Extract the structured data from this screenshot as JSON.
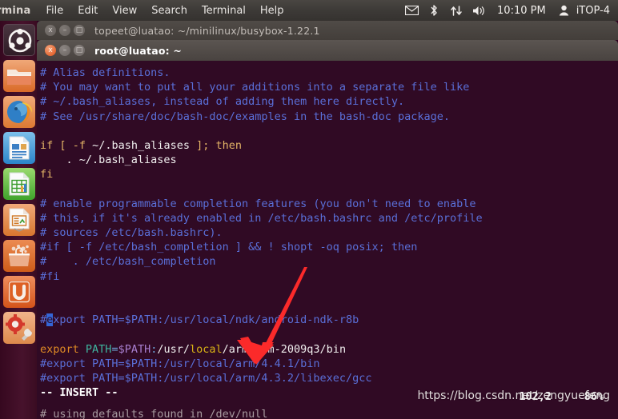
{
  "top_panel": {
    "app_name": "Terminal",
    "app_name_visible": "ermina",
    "menus": [
      "File",
      "Edit",
      "View",
      "Search",
      "Terminal",
      "Help"
    ],
    "tray_icons": [
      "mail-icon",
      "bluetooth-icon",
      "network-icon",
      "volume-icon"
    ],
    "clock": "10:10 PM",
    "user_icon": "user-icon",
    "username": "iTOP-4",
    "bg_color": "#3d3a37"
  },
  "launcher": {
    "items": [
      {
        "name": "ubuntu-dash-icon",
        "label": "Dash Home"
      },
      {
        "name": "files-icon",
        "label": "Files"
      },
      {
        "name": "firefox-icon",
        "label": "Firefox Web Browser"
      },
      {
        "name": "libreoffice-writer-icon",
        "label": "LibreOffice Writer"
      },
      {
        "name": "libreoffice-calc-icon",
        "label": "LibreOffice Calc"
      },
      {
        "name": "libreoffice-impress-icon",
        "label": "LibreOffice Impress"
      },
      {
        "name": "software-center-icon",
        "label": "Ubuntu Software Center"
      },
      {
        "name": "ubuntu-one-icon",
        "label": "Ubuntu One"
      },
      {
        "name": "system-settings-icon",
        "label": "System Settings"
      }
    ],
    "bg_color": "#3a0c22"
  },
  "windows": {
    "background_window": {
      "title": "topeet@luatao: ~/minilinux/busybox-1.22.1",
      "close_label": "x",
      "minimize_label": "–",
      "maximize_label": "□"
    },
    "foreground_window": {
      "title": "root@luatao: ~",
      "close_label": "x",
      "minimize_label": "–",
      "maximize_label": "□"
    }
  },
  "terminal": {
    "bg_color": "#300a24",
    "comment_color": "#5a6fd8",
    "keyword_color": "#e5b567",
    "status_line": "-- INSERT --",
    "ruler": "102,2",
    "ruler_percent": "86%",
    "bottom_partial_line": "# using defaults found in /dev/null",
    "lines": [
      {
        "id": "l1",
        "text": "# Alias definitions."
      },
      {
        "id": "l2",
        "text": "# You may want to put all your additions into a separate file like"
      },
      {
        "id": "l3",
        "text": "# ~/.bash_aliases, instead of adding them here directly."
      },
      {
        "id": "l4",
        "text": "# See /usr/share/doc/bash-doc/examples in the bash-doc package."
      },
      {
        "id": "l5",
        "text": ""
      },
      {
        "id": "l6",
        "text": "if [ -f ~/.bash_aliases ]; then"
      },
      {
        "id": "l7",
        "text": "    . ~/.bash_aliases"
      },
      {
        "id": "l8",
        "text": "fi"
      },
      {
        "id": "l9",
        "text": ""
      },
      {
        "id": "l10",
        "text": "# enable programmable completion features (you don't need to enable"
      },
      {
        "id": "l11",
        "text": "# this, if it's already enabled in /etc/bash.bashrc and /etc/profile"
      },
      {
        "id": "l12",
        "text": "# sources /etc/bash.bashrc)."
      },
      {
        "id": "l13",
        "text": "#if [ -f /etc/bash_completion ] && ! shopt -oq posix; then"
      },
      {
        "id": "l14",
        "text": "#    . /etc/bash_completion"
      },
      {
        "id": "l15",
        "text": "#fi"
      },
      {
        "id": "l16",
        "text": ""
      },
      {
        "id": "l17",
        "text": ""
      },
      {
        "id": "l18",
        "text": "#export PATH=$PATH:/usr/local/ndk/android-ndk-r8b"
      },
      {
        "id": "l19",
        "text": ""
      },
      {
        "id": "l20",
        "text": "export PATH=$PATH:/usr/local/arm/arm-2009q3/bin"
      },
      {
        "id": "l21",
        "text": "#export PATH=$PATH:/usr/local/arm/4.4.1/bin"
      },
      {
        "id": "l22",
        "text": "#export PATH=$PATH:/usr/local/arm/4.3.2/libexec/gcc"
      }
    ]
  },
  "annotation": {
    "arrow_color": "#fb2a2a",
    "arrow_name": "red-pointer-arrow"
  },
  "watermark": {
    "text": "https://blog.csdn.net/zengyuefeng"
  }
}
